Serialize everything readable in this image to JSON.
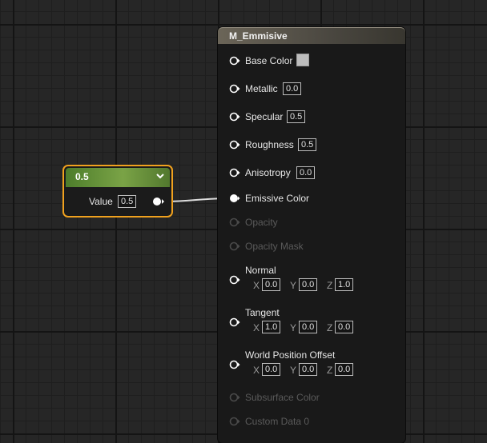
{
  "scalar_node": {
    "title": "0.5",
    "value_label": "Value",
    "value": "0.5"
  },
  "material_node": {
    "title": "M_Emmisive",
    "inputs": [
      {
        "label": "Base Color"
      },
      {
        "label": "Metallic",
        "value": "0.0"
      },
      {
        "label": "Specular",
        "value": "0.5"
      },
      {
        "label": "Roughness",
        "value": "0.5"
      },
      {
        "label": "Anisotropy",
        "value": "0.0"
      },
      {
        "label": "Emissive Color",
        "connected": true
      },
      {
        "label": "Opacity",
        "disabled": true
      },
      {
        "label": "Opacity Mask",
        "disabled": true
      },
      {
        "label": "Normal",
        "x": "0.0",
        "y": "0.0",
        "z": "1.0"
      },
      {
        "label": "Tangent",
        "x": "1.0",
        "y": "0.0",
        "z": "0.0"
      },
      {
        "label": "World Position Offset",
        "x": "0.0",
        "y": "0.0",
        "z": "0.0"
      },
      {
        "label": "Subsurface Color",
        "disabled": true
      },
      {
        "label": "Custom Data 0",
        "disabled": true
      }
    ],
    "axis_labels": {
      "x": "X",
      "y": "Y",
      "z": "Z"
    }
  },
  "colors": {
    "selection_outline": "#f0a11e",
    "scalar_header": "#7aa346",
    "material_header": "#6b6558",
    "base_color_swatch": "#bdbdbd"
  }
}
